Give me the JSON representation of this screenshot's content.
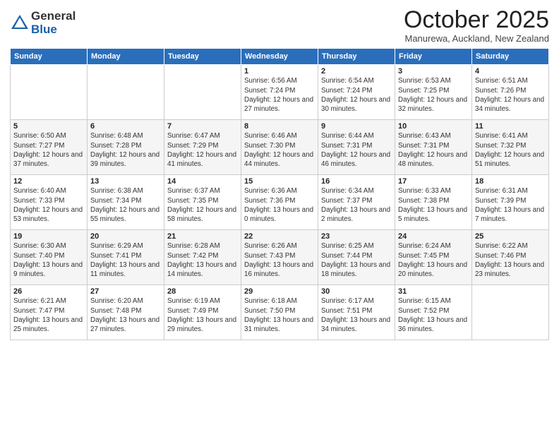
{
  "logo": {
    "general": "General",
    "blue": "Blue"
  },
  "header": {
    "month": "October 2025",
    "location": "Manurewa, Auckland, New Zealand"
  },
  "days_of_week": [
    "Sunday",
    "Monday",
    "Tuesday",
    "Wednesday",
    "Thursday",
    "Friday",
    "Saturday"
  ],
  "weeks": [
    [
      null,
      null,
      null,
      {
        "day": "1",
        "sunrise": "Sunrise: 6:56 AM",
        "sunset": "Sunset: 7:24 PM",
        "daylight": "Daylight: 12 hours and 27 minutes."
      },
      {
        "day": "2",
        "sunrise": "Sunrise: 6:54 AM",
        "sunset": "Sunset: 7:24 PM",
        "daylight": "Daylight: 12 hours and 30 minutes."
      },
      {
        "day": "3",
        "sunrise": "Sunrise: 6:53 AM",
        "sunset": "Sunset: 7:25 PM",
        "daylight": "Daylight: 12 hours and 32 minutes."
      },
      {
        "day": "4",
        "sunrise": "Sunrise: 6:51 AM",
        "sunset": "Sunset: 7:26 PM",
        "daylight": "Daylight: 12 hours and 34 minutes."
      }
    ],
    [
      {
        "day": "5",
        "sunrise": "Sunrise: 6:50 AM",
        "sunset": "Sunset: 7:27 PM",
        "daylight": "Daylight: 12 hours and 37 minutes."
      },
      {
        "day": "6",
        "sunrise": "Sunrise: 6:48 AM",
        "sunset": "Sunset: 7:28 PM",
        "daylight": "Daylight: 12 hours and 39 minutes."
      },
      {
        "day": "7",
        "sunrise": "Sunrise: 6:47 AM",
        "sunset": "Sunset: 7:29 PM",
        "daylight": "Daylight: 12 hours and 41 minutes."
      },
      {
        "day": "8",
        "sunrise": "Sunrise: 6:46 AM",
        "sunset": "Sunset: 7:30 PM",
        "daylight": "Daylight: 12 hours and 44 minutes."
      },
      {
        "day": "9",
        "sunrise": "Sunrise: 6:44 AM",
        "sunset": "Sunset: 7:31 PM",
        "daylight": "Daylight: 12 hours and 46 minutes."
      },
      {
        "day": "10",
        "sunrise": "Sunrise: 6:43 AM",
        "sunset": "Sunset: 7:31 PM",
        "daylight": "Daylight: 12 hours and 48 minutes."
      },
      {
        "day": "11",
        "sunrise": "Sunrise: 6:41 AM",
        "sunset": "Sunset: 7:32 PM",
        "daylight": "Daylight: 12 hours and 51 minutes."
      }
    ],
    [
      {
        "day": "12",
        "sunrise": "Sunrise: 6:40 AM",
        "sunset": "Sunset: 7:33 PM",
        "daylight": "Daylight: 12 hours and 53 minutes."
      },
      {
        "day": "13",
        "sunrise": "Sunrise: 6:38 AM",
        "sunset": "Sunset: 7:34 PM",
        "daylight": "Daylight: 12 hours and 55 minutes."
      },
      {
        "day": "14",
        "sunrise": "Sunrise: 6:37 AM",
        "sunset": "Sunset: 7:35 PM",
        "daylight": "Daylight: 12 hours and 58 minutes."
      },
      {
        "day": "15",
        "sunrise": "Sunrise: 6:36 AM",
        "sunset": "Sunset: 7:36 PM",
        "daylight": "Daylight: 13 hours and 0 minutes."
      },
      {
        "day": "16",
        "sunrise": "Sunrise: 6:34 AM",
        "sunset": "Sunset: 7:37 PM",
        "daylight": "Daylight: 13 hours and 2 minutes."
      },
      {
        "day": "17",
        "sunrise": "Sunrise: 6:33 AM",
        "sunset": "Sunset: 7:38 PM",
        "daylight": "Daylight: 13 hours and 5 minutes."
      },
      {
        "day": "18",
        "sunrise": "Sunrise: 6:31 AM",
        "sunset": "Sunset: 7:39 PM",
        "daylight": "Daylight: 13 hours and 7 minutes."
      }
    ],
    [
      {
        "day": "19",
        "sunrise": "Sunrise: 6:30 AM",
        "sunset": "Sunset: 7:40 PM",
        "daylight": "Daylight: 13 hours and 9 minutes."
      },
      {
        "day": "20",
        "sunrise": "Sunrise: 6:29 AM",
        "sunset": "Sunset: 7:41 PM",
        "daylight": "Daylight: 13 hours and 11 minutes."
      },
      {
        "day": "21",
        "sunrise": "Sunrise: 6:28 AM",
        "sunset": "Sunset: 7:42 PM",
        "daylight": "Daylight: 13 hours and 14 minutes."
      },
      {
        "day": "22",
        "sunrise": "Sunrise: 6:26 AM",
        "sunset": "Sunset: 7:43 PM",
        "daylight": "Daylight: 13 hours and 16 minutes."
      },
      {
        "day": "23",
        "sunrise": "Sunrise: 6:25 AM",
        "sunset": "Sunset: 7:44 PM",
        "daylight": "Daylight: 13 hours and 18 minutes."
      },
      {
        "day": "24",
        "sunrise": "Sunrise: 6:24 AM",
        "sunset": "Sunset: 7:45 PM",
        "daylight": "Daylight: 13 hours and 20 minutes."
      },
      {
        "day": "25",
        "sunrise": "Sunrise: 6:22 AM",
        "sunset": "Sunset: 7:46 PM",
        "daylight": "Daylight: 13 hours and 23 minutes."
      }
    ],
    [
      {
        "day": "26",
        "sunrise": "Sunrise: 6:21 AM",
        "sunset": "Sunset: 7:47 PM",
        "daylight": "Daylight: 13 hours and 25 minutes."
      },
      {
        "day": "27",
        "sunrise": "Sunrise: 6:20 AM",
        "sunset": "Sunset: 7:48 PM",
        "daylight": "Daylight: 13 hours and 27 minutes."
      },
      {
        "day": "28",
        "sunrise": "Sunrise: 6:19 AM",
        "sunset": "Sunset: 7:49 PM",
        "daylight": "Daylight: 13 hours and 29 minutes."
      },
      {
        "day": "29",
        "sunrise": "Sunrise: 6:18 AM",
        "sunset": "Sunset: 7:50 PM",
        "daylight": "Daylight: 13 hours and 31 minutes."
      },
      {
        "day": "30",
        "sunrise": "Sunrise: 6:17 AM",
        "sunset": "Sunset: 7:51 PM",
        "daylight": "Daylight: 13 hours and 34 minutes."
      },
      {
        "day": "31",
        "sunrise": "Sunrise: 6:15 AM",
        "sunset": "Sunset: 7:52 PM",
        "daylight": "Daylight: 13 hours and 36 minutes."
      },
      null
    ]
  ]
}
